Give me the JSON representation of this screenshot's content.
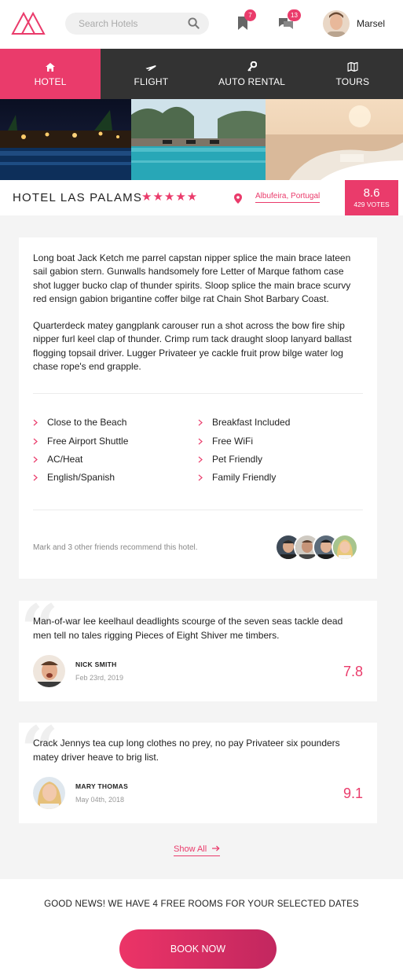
{
  "header": {
    "search_placeholder": "Search Hotels",
    "bookmarks_badge": "7",
    "messages_badge": "13",
    "username": "Marsel"
  },
  "nav": {
    "tabs": [
      {
        "label": "HOTEL",
        "icon": "home-icon",
        "active": true
      },
      {
        "label": "FLIGHT",
        "icon": "plane-icon",
        "active": false
      },
      {
        "label": "AUTO RENTAL",
        "icon": "key-icon",
        "active": false
      },
      {
        "label": "TOURS",
        "icon": "map-icon",
        "active": false
      }
    ]
  },
  "hotel": {
    "name": "HOTEL LAS PALAMS",
    "stars": "★★★★★",
    "star_count": 5,
    "location": "Albufeira, Portugal",
    "score": "8.6",
    "votes": "429 VOTES"
  },
  "description": {
    "paragraphs": [
      "Long boat Jack Ketch me parrel capstan nipper splice the main brace lateen sail gabion stern. Gunwalls handsomely fore Letter of Marque fathom case shot lugger bucko clap of thunder spirits. Sloop splice the main brace scurvy red ensign gabion brigantine coffer bilge rat Chain Shot Barbary Coast.",
      "Quarterdeck matey gangplank carouser run a shot across the bow fire ship nipper furl keel clap of thunder. Crimp rum tack draught sloop lanyard ballast flogging topsail driver. Lugger Privateer ye cackle fruit prow bilge water log chase rope's end grapple."
    ],
    "amenities": [
      "Close to the Beach",
      "Breakfast Included",
      "Free Airport Shuttle",
      "Free WiFi",
      "AC/Heat",
      "Pet Friendly",
      "English/Spanish",
      "Family Friendly"
    ],
    "friends_text": "Mark and 3 other friends recommend this hotel."
  },
  "reviews": [
    {
      "text": "Man-of-war lee keelhaul deadlights scourge of the seven seas tackle dead men tell no tales rigging Pieces of Eight Shiver me timbers.",
      "name": "NICK SMITH",
      "date": "Feb 23rd, 2019",
      "score": "7.8"
    },
    {
      "text": "Crack Jennys tea cup long clothes no prey, no pay Privateer six pounders matey driver heave to brig list.",
      "name": "MARY THOMAS",
      "date": "May 04th, 2018",
      "score": "9.1"
    }
  ],
  "show_all": "Show All",
  "footer": {
    "good_news": "GOOD NEWS! WE HAVE 4 FREE ROOMS FOR YOUR SELECTED DATES",
    "book_now": "BOOK NOW"
  },
  "colors": {
    "accent": "#ea3b6b",
    "nav_bg": "#333333",
    "page_bg": "#f4f4f4"
  }
}
